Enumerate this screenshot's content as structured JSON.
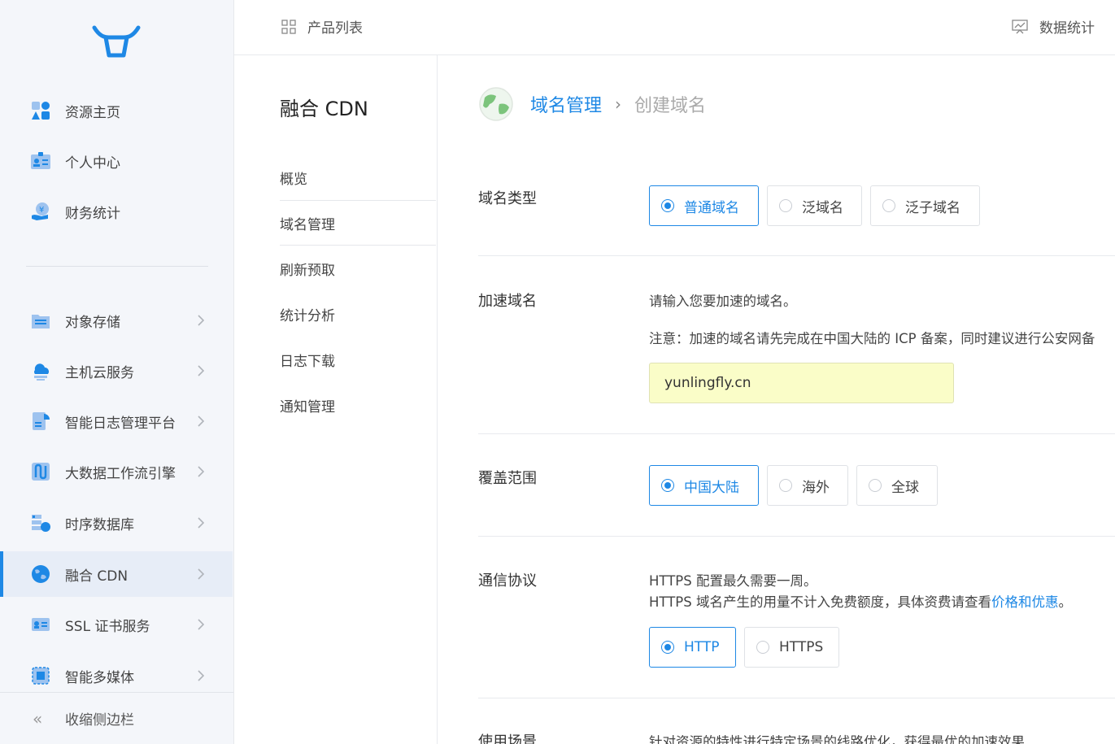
{
  "brand_color": "#1e88e5",
  "sidebar": {
    "items": [
      {
        "label": "资源主页",
        "icon": "resource-home-icon"
      },
      {
        "label": "个人中心",
        "icon": "personal-center-icon"
      },
      {
        "label": "财务统计",
        "icon": "finance-icon"
      },
      {
        "label": "对象存储",
        "icon": "object-storage-icon"
      },
      {
        "label": "主机云服务",
        "icon": "cloud-host-icon"
      },
      {
        "label": "智能日志管理平台",
        "icon": "log-platform-icon"
      },
      {
        "label": "大数据工作流引擎",
        "icon": "workflow-icon"
      },
      {
        "label": "时序数据库",
        "icon": "tsdb-icon"
      },
      {
        "label": "融合 CDN",
        "icon": "cdn-icon"
      },
      {
        "label": "SSL 证书服务",
        "icon": "ssl-icon"
      },
      {
        "label": "智能多媒体",
        "icon": "multimedia-icon"
      }
    ],
    "collapse_label": "收缩侧边栏"
  },
  "header": {
    "product_list": "产品列表",
    "data_stats": "数据统计"
  },
  "submenu": {
    "title": "融合 CDN",
    "items": [
      "概览",
      "域名管理",
      "刷新预取",
      "统计分析",
      "日志下载",
      "通知管理"
    ]
  },
  "breadcrumb": {
    "parent": "域名管理",
    "current": "创建域名"
  },
  "form": {
    "domain_type": {
      "label": "域名类型",
      "options": [
        "普通域名",
        "泛域名",
        "泛子域名"
      ],
      "selected": "普通域名"
    },
    "accel_domain": {
      "label": "加速域名",
      "hint1": "请输入您要加速的域名。",
      "hint2": "注意：加速的域名请先完成在中国大陆的 ICP 备案，同时建议进行公安网备",
      "value": "yunlingfly.cn"
    },
    "coverage": {
      "label": "覆盖范围",
      "options": [
        "中国大陆",
        "海外",
        "全球"
      ],
      "selected": "中国大陆"
    },
    "protocol": {
      "label": "通信协议",
      "note1": "HTTPS 配置最久需要一周。",
      "note2_prefix": "HTTPS 域名产生的用量不计入免费额度，具体资费请查看",
      "note2_link": "价格和优惠",
      "note2_suffix": "。",
      "options": [
        "HTTP",
        "HTTPS"
      ],
      "selected": "HTTP"
    },
    "scenario": {
      "label": "使用场景",
      "desc": "针对资源的特性进行特定场景的线路优化，获得最优的加速效果"
    }
  }
}
